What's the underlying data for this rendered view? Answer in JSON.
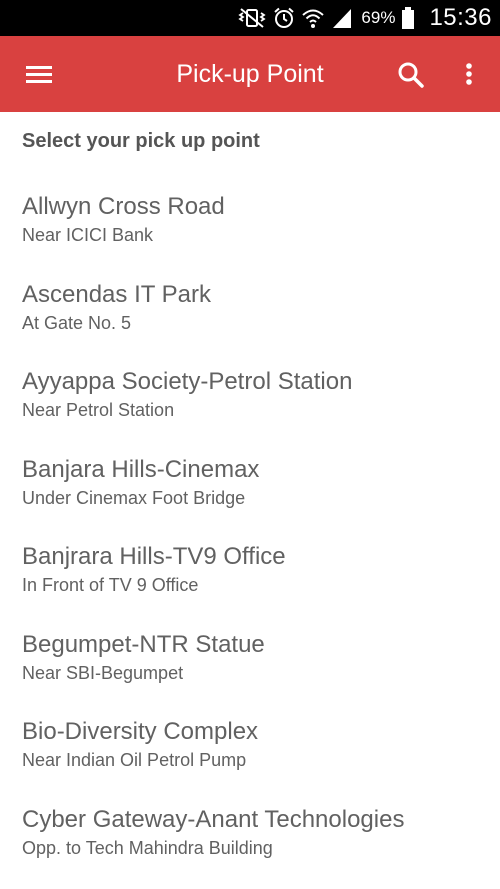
{
  "status_bar": {
    "battery_percent": "69%",
    "time": "15:36",
    "icons": [
      "mute-vibrate-icon",
      "alarm-icon",
      "wifi-icon",
      "signal-icon",
      "battery-icon"
    ]
  },
  "app_bar": {
    "title": "Pick-up Point",
    "background_color": "#d94140",
    "icons": [
      "menu-icon",
      "search-icon",
      "more-vert-icon"
    ]
  },
  "section": {
    "title": "Select your pick up point"
  },
  "pickup_points": [
    {
      "name": "Allwyn Cross Road",
      "landmark": "Near ICICI Bank"
    },
    {
      "name": "Ascendas IT Park",
      "landmark": "At Gate No. 5"
    },
    {
      "name": "Ayyappa Society-Petrol Station",
      "landmark": "Near Petrol Station"
    },
    {
      "name": "Banjara Hills-Cinemax",
      "landmark": "Under Cinemax Foot Bridge"
    },
    {
      "name": "Banjrara Hills-TV9 Office",
      "landmark": "In Front of TV 9 Office"
    },
    {
      "name": "Begumpet-NTR Statue",
      "landmark": "Near SBI-Begumpet"
    },
    {
      "name": "Bio-Diversity Complex",
      "landmark": "Near Indian Oil Petrol Pump"
    },
    {
      "name": "Cyber Gateway-Anant Technologies",
      "landmark": "Opp. to Tech Mahindra Building"
    }
  ]
}
